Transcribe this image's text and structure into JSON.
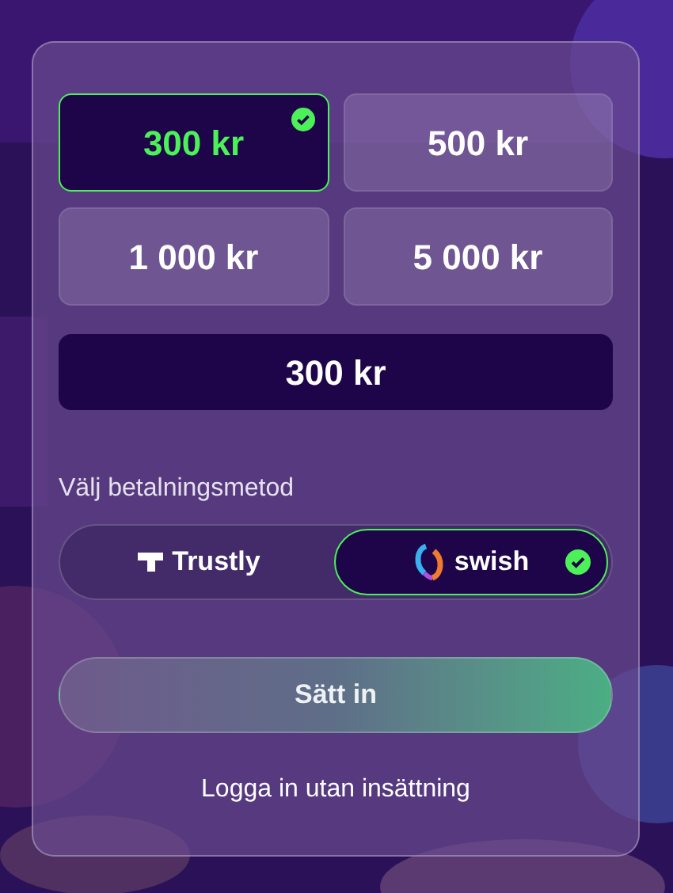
{
  "amounts": [
    {
      "label": "300 kr",
      "selected": true
    },
    {
      "label": "500 kr",
      "selected": false
    },
    {
      "label": "1 000 kr",
      "selected": false
    },
    {
      "label": "5 000 kr",
      "selected": false
    }
  ],
  "amount_field": {
    "value": "300 kr"
  },
  "payment_label": "Välj betalningsmetod",
  "methods": [
    {
      "kind": "trustly",
      "label": "Trustly",
      "selected": false
    },
    {
      "kind": "swish",
      "label": "swish",
      "selected": true
    }
  ],
  "deposit_button": "Sätt in",
  "login_link": "Logga in utan insättning"
}
